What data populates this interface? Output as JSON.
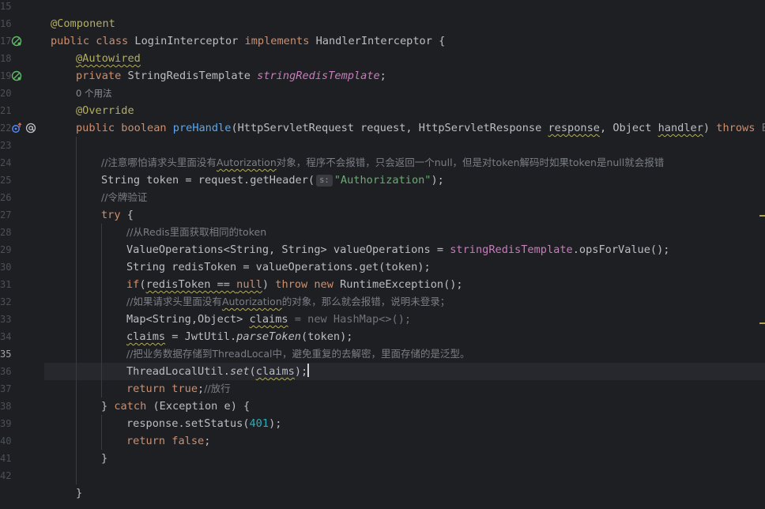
{
  "gutter": {
    "line_numbers": [
      "15",
      "16",
      "17",
      "18",
      "19",
      "20",
      "21",
      "22",
      "23",
      "24",
      "25",
      "26",
      "27",
      "28",
      "29",
      "30",
      "31",
      "32",
      "33",
      "34",
      "35",
      "36",
      "37",
      "38",
      "39",
      "40",
      "41",
      "42"
    ],
    "current_line": "35"
  },
  "code": {
    "l16_ann": "@Component",
    "l17_kw1": "public class",
    "l17_name": " LoginInterceptor ",
    "l17_kw2": "implements",
    "l17_rest": " HandlerInterceptor {",
    "l18_ann": "@Autowired",
    "l19_kw": "private",
    "l19_type": " StringRedisTemplate ",
    "l19_field": "stringRedisTemplate",
    "l19_end": ";",
    "usages": "0 个用法",
    "l20_ann": "@Override",
    "l21_kw": "public boolean ",
    "l21_fn": "preHandle",
    "l21_a": "(HttpServletRequest request, HttpServletResponse ",
    "l21_response": "response",
    "l21_b": ", Object ",
    "l21_handler": "handler",
    "l21_c": ") ",
    "l21_throws": "throws",
    "l21_exc": " Exc",
    "l23_c1": "//注意哪怕请求头里面没有",
    "l23_c2": "Autorization",
    "l23_c3": "对象，程序不会报错，只会返回一个null，但是对token解码时如果token是null就会报错",
    "l24_a": "String token = request.getHeader(",
    "l24_hint": "s:",
    "l24_str": "\"Authorization\"",
    "l24_end": ");",
    "l25_c": "//令牌验证",
    "l26_kw": "try",
    "l26_end": " {",
    "l27_c": "//从Redis里面获取相同的token",
    "l28_a": "ValueOperations<String, String> valueOperations = ",
    "l28_field": "stringRedisTemplate",
    "l28_end": ".opsForValue();",
    "l29": "String redisToken = valueOperations.get(token);",
    "l30_if": "if",
    "l30_a": "(",
    "l30_cond": "redisToken == ",
    "l30_null": "null",
    "l30_b": ") ",
    "l30_throw": "throw",
    "l30_sp": " ",
    "l30_new": "new",
    "l30_end": " RuntimeException();",
    "l31_c1": "//如果请求头里面没有",
    "l31_c2": "Autorization",
    "l31_c3": "的对象，那么就会报错，说明未登录；",
    "l32_a": "Map<String,Object> ",
    "l32_claims": "claims",
    "l32_dim": " = new HashMap<>();",
    "l33_claims": "claims",
    "l33_a": " = JwtUtil.",
    "l33_fn": "parseToken",
    "l33_end": "(token);",
    "l34_c": "//把业务数据存储到ThreadLocal中，避免重复的去解密，里面存储的是泛型。",
    "l35_a": "ThreadLocalUtil.",
    "l35_fn": "set",
    "l35_b": "(",
    "l35_claims": "claims",
    "l35_end": ");",
    "l36_kw": "return true",
    "l36_semi": ";",
    "l36_c": "//放行",
    "l37_a": "} ",
    "l37_kw": "catch",
    "l37_end": " (Exception e) {",
    "l38_a": "response.setStatus(",
    "l38_num": "401",
    "l38_end": ");",
    "l39_kw": "return false",
    "l39_end": ";",
    "l40": "}",
    "l42": "}"
  },
  "colors": {
    "background": "#1e1f22",
    "keyword": "#cf8e6d",
    "annotation": "#b3ae60",
    "method": "#56a8f5",
    "field": "#c77dbb",
    "string": "#6aab73",
    "number": "#2aacb8",
    "comment": "#7a7e85"
  },
  "icons": [
    "bean-icon",
    "bean-icon",
    "override-up-arrow-icon",
    "annotation-at-icon"
  ]
}
